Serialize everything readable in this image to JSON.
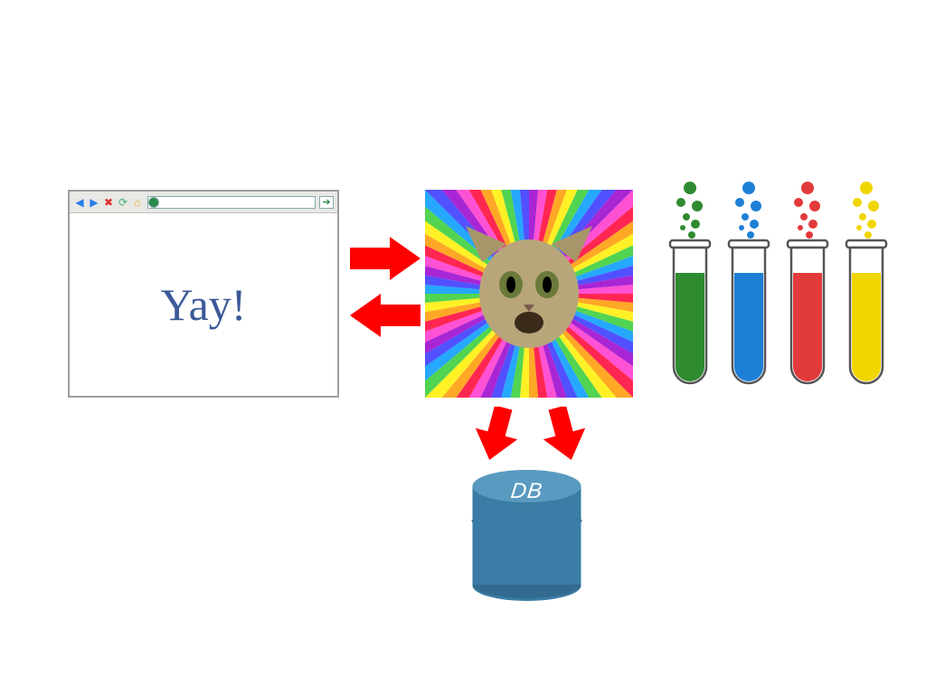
{
  "browser": {
    "content_text": "Yay!"
  },
  "database": {
    "label": "DB",
    "color": "#3a7ca5"
  },
  "test_tubes": {
    "colors": [
      "#2e8b2f",
      "#1e7fd6",
      "#e23a3a",
      "#f0d600"
    ],
    "names": [
      "green",
      "blue",
      "red",
      "yellow"
    ]
  },
  "arrows": {
    "color": "#ff0000"
  }
}
